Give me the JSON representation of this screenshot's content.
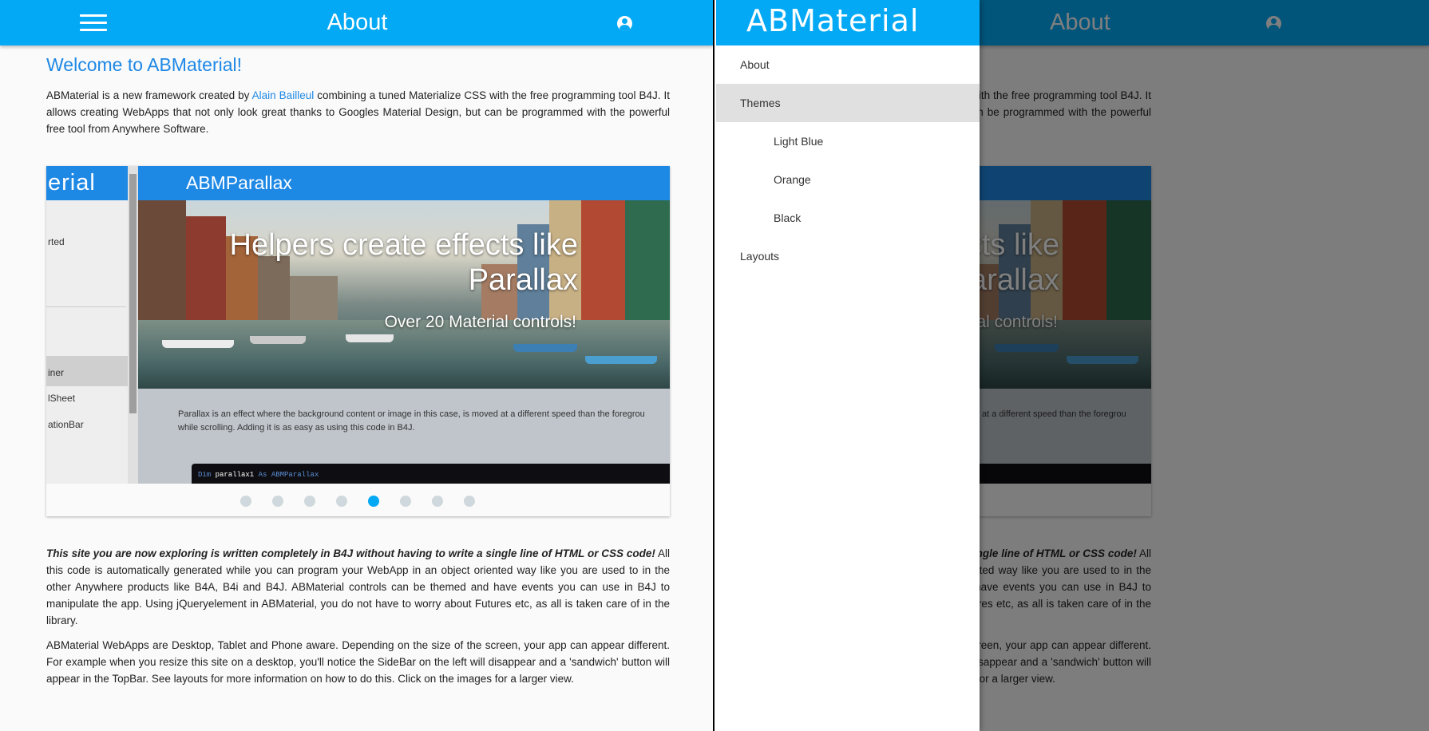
{
  "colors": {
    "primary": "#03a9f4",
    "link": "#1e88e5",
    "overlay": "rgba(0,0,0,0.5)"
  },
  "topbar": {
    "title": "About",
    "menu_icon": "hamburger-menu-icon",
    "account_icon": "account-circle-icon"
  },
  "page": {
    "heading": "Welcome to ABMaterial!",
    "intro_before_link": "ABMaterial is a new framework created by ",
    "intro_link": "Alain Bailleul",
    "intro_after_link": " combining a tuned Materialize CSS with the free programming tool B4J. It allows creating WebApps that not only look great thanks to Googles Material Design, but can be programmed with the powerful free tool from Anywhere Software.",
    "para2_bold": "This site you are now exploring is written completely in B4J without having to write a single line of HTML or CSS code!",
    "para2_rest": " All this code is automatically generated while you can program your WebApp in an object oriented way like you are used to in the other Anywhere products like B4A, B4i and B4J. ABMaterial controls can be themed and have events you can use in B4J to manipulate the app. Using jQueryelement in ABMaterial, you do not have to worry about Futures etc, as all is taken care of in the library.",
    "para3": "ABMaterial WebApps are Desktop, Tablet and Phone aware. Depending on the size of the screen, your app can appear different. For example when you resize this site on a desktop, you'll notice the SideBar on the left will disappear and a 'sandwich' button will appear in the TopBar. See layouts for more information on how to do this. Click on the images for a larger view."
  },
  "carousel": {
    "slide_logo": "erial",
    "slide_header": "ABMParallax",
    "slide_sidebar_items": [
      "rted",
      "iner",
      "lSheet",
      "ationBar"
    ],
    "slide_title_line1": "Helpers create effects like",
    "slide_title_line2": "Parallax",
    "slide_subtitle": "Over 20 Material controls!",
    "slide_desc_line1": "Parallax is an effect where the background content or image in this case, is moved at a different speed than the foregrou",
    "slide_desc_line2": "while scrolling. Adding it is as easy as using this code in B4J.",
    "slide_code_kw1": "Dim",
    "slide_code_var": " parallax1 ",
    "slide_code_kw2": "As ABMParallax",
    "dots": 8,
    "active_dot": 5
  },
  "drawer": {
    "logo": "ABMaterial",
    "items": [
      {
        "label": "About",
        "level": 0,
        "selected": false
      },
      {
        "label": "Themes",
        "level": 0,
        "selected": true
      },
      {
        "label": "Light Blue",
        "level": 1,
        "selected": false
      },
      {
        "label": "Orange",
        "level": 1,
        "selected": false
      },
      {
        "label": "Black",
        "level": 1,
        "selected": false
      },
      {
        "label": "Layouts",
        "level": 0,
        "selected": false
      }
    ]
  }
}
